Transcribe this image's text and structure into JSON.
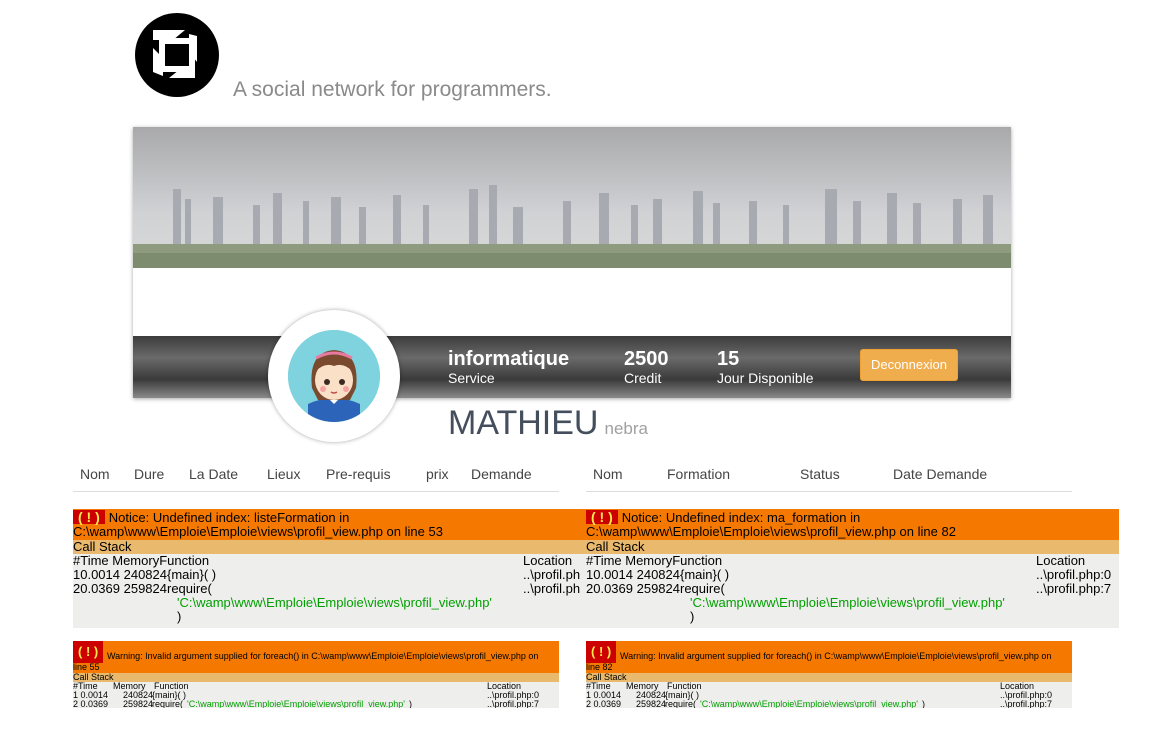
{
  "brand": {
    "tagline": "A social network for programmers."
  },
  "profile": {
    "service_value": "informatique",
    "service_label": "Service",
    "credit_value": "2500",
    "credit_label": "Credit",
    "days_value": "15",
    "days_label": "Jour Disponible",
    "logout_label": "Deconnexion",
    "name": "MATHIEU",
    "username": "nebra"
  },
  "left_table": {
    "headers": [
      "Nom",
      "Dure",
      "La Date",
      "Lieux",
      "Pre-requis",
      "prix",
      "Demande"
    ]
  },
  "right_table": {
    "headers": [
      "Nom",
      "Formation",
      "Status",
      "Date Demande"
    ]
  },
  "errors": {
    "badge": "( ! )",
    "notice_left": {
      "line1": "Notice: Undefined index: listeFormation in",
      "line2": "C:\\wamp\\www\\Emploie\\Emploie\\views\\profil_view.php on line 53"
    },
    "notice_right": {
      "line1": "Notice: Undefined index: ma_formation in",
      "line2": "C:\\wamp\\www\\Emploie\\Emploie\\views\\profil_view.php on line 82"
    },
    "call_stack": "Call Stack",
    "cols": "#Time   MemoryFunction",
    "cols_location": "Location",
    "row1": "10.0014 240824{main}( )",
    "row2": "20.0369 259824require(",
    "row2_arg": "'C:\\wamp\\www\\Emploie\\Emploie\\views\\profil_view.php'",
    "row2_close": ")",
    "loc_left_1": "..\\profil.ph",
    "loc_left_2": "..\\profil.ph",
    "loc_right_1": "..\\profil.php:0",
    "loc_right_2": "..\\profil.php:7",
    "warning_left": "Warning: Invalid argument supplied for foreach() in C:\\wamp\\www\\Emploie\\Emploie\\views\\profil_view.php on",
    "warning_left_line": "line 55",
    "warning_right": "Warning: Invalid argument supplied for foreach() in C:\\wamp\\www\\Emploie\\Emploie\\views\\profil_view.php on",
    "warning_right_line": "line 82",
    "small_cols_time": "#Time",
    "small_cols_memory": "Memory",
    "small_cols_function": "Function",
    "small_row1": "1 0.0014",
    "small_row1_mem": "240824",
    "small_row1_fn": "{main}( )",
    "small_row2": "2 0.0369",
    "small_row2_mem": "259824",
    "small_row2_fn": "require(",
    "small_row2_arg": "'C:\\wamp\\www\\Emploie\\Emploie\\views\\profil_view.php'",
    "small_row2_close": ")",
    "small_loc_1": "..\\profil.php:0",
    "small_loc_2": "..\\profil.php:7"
  }
}
